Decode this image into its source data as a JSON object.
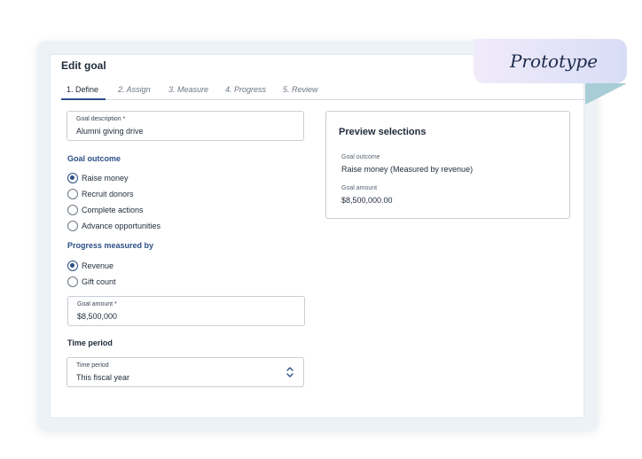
{
  "badge": {
    "text": "Prototype"
  },
  "page": {
    "title": "Edit goal"
  },
  "tabs": [
    {
      "label": "1. Define",
      "active": true
    },
    {
      "label": "2. Assign",
      "active": false
    },
    {
      "label": "3. Measure",
      "active": false
    },
    {
      "label": "4. Progress",
      "active": false
    },
    {
      "label": "5. Review",
      "active": false
    }
  ],
  "goal_description": {
    "label": "Goal description *",
    "value": "Alumni giving drive"
  },
  "goal_outcome": {
    "heading": "Goal outcome",
    "options": [
      {
        "label": "Raise money",
        "checked": true
      },
      {
        "label": "Recruit donors",
        "checked": false
      },
      {
        "label": "Complete actions",
        "checked": false
      },
      {
        "label": "Advance opportunities",
        "checked": false
      }
    ]
  },
  "progress_measured_by": {
    "heading": "Progress measured by",
    "options": [
      {
        "label": "Revenue",
        "checked": true
      },
      {
        "label": "Gift count",
        "checked": false
      }
    ]
  },
  "goal_amount": {
    "label": "Goal amount *",
    "value": "$8,500,000"
  },
  "time_period": {
    "heading": "Time period",
    "label": "Time period",
    "value": "This fiscal year"
  },
  "preview": {
    "title": "Preview selections",
    "outcome_label": "Goal outcome",
    "outcome_value": "Raise money (Measured by revenue)",
    "amount_label": "Goal amount",
    "amount_value": "$8,500,000.00"
  },
  "colors": {
    "accent": "#2d4f86",
    "text": "#1f2a3a",
    "badge_fold": "#a9cdd6"
  }
}
